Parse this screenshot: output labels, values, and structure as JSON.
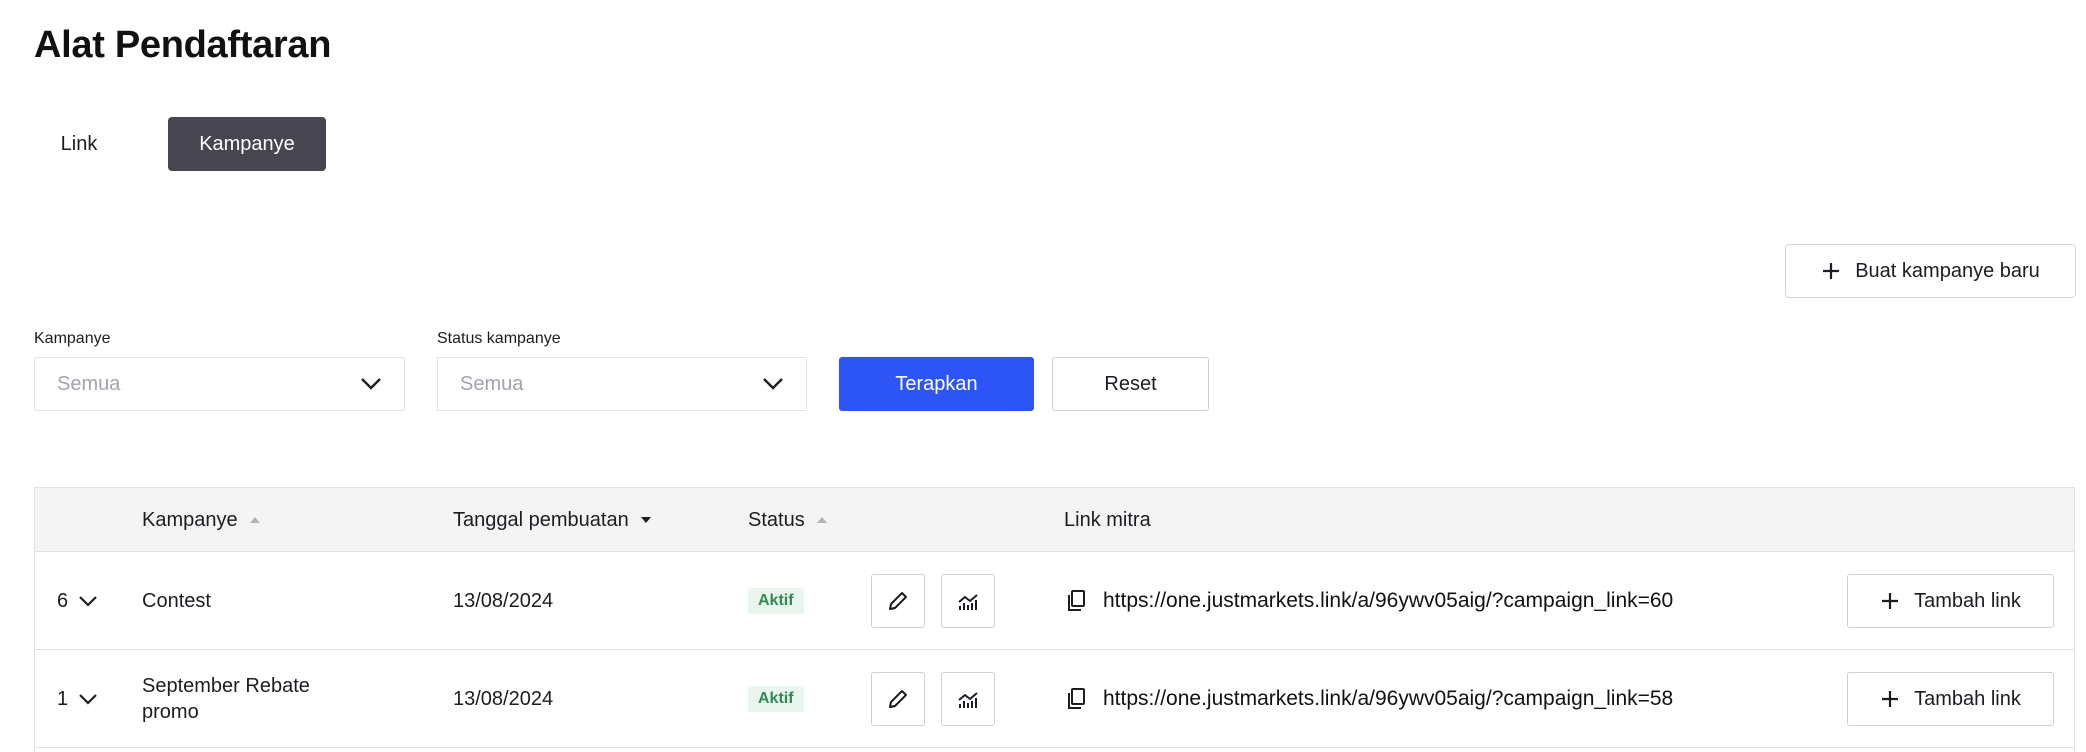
{
  "page": {
    "title": "Alat Pendaftaran"
  },
  "tabs": [
    {
      "label": "Link",
      "active": false
    },
    {
      "label": "Kampanye",
      "active": true
    }
  ],
  "actions": {
    "new_campaign_label": "Buat kampanye baru"
  },
  "filters": {
    "campaign": {
      "label": "Kampanye",
      "value": "Semua"
    },
    "status": {
      "label": "Status kampanye",
      "value": "Semua"
    },
    "apply_label": "Terapkan",
    "reset_label": "Reset"
  },
  "table": {
    "columns": {
      "campaign": "Kampanye",
      "created": "Tanggal pembuatan",
      "status": "Status",
      "partner_link": "Link mitra"
    },
    "add_link_label": "Tambah link",
    "rows": [
      {
        "count": "6",
        "name": "Contest",
        "date": "13/08/2024",
        "status": "Aktif",
        "link": "https://one.justmarkets.link/a/96ywv05aig/?campaign_link=60"
      },
      {
        "count": "1",
        "name": "September Rebate promo",
        "date": "13/08/2024",
        "status": "Aktif",
        "link": "https://one.justmarkets.link/a/96ywv05aig/?campaign_link=58"
      }
    ]
  },
  "colors": {
    "accent": "#2d54f5",
    "active_tab": "#47454f",
    "status_active_bg": "#e9f6ee",
    "status_active_text": "#2f8a57"
  },
  "icons": [
    "plus-icon",
    "chevron-down-icon",
    "sort-up-icon",
    "sort-down-icon",
    "pencil-icon",
    "stats-icon",
    "copy-icon"
  ]
}
